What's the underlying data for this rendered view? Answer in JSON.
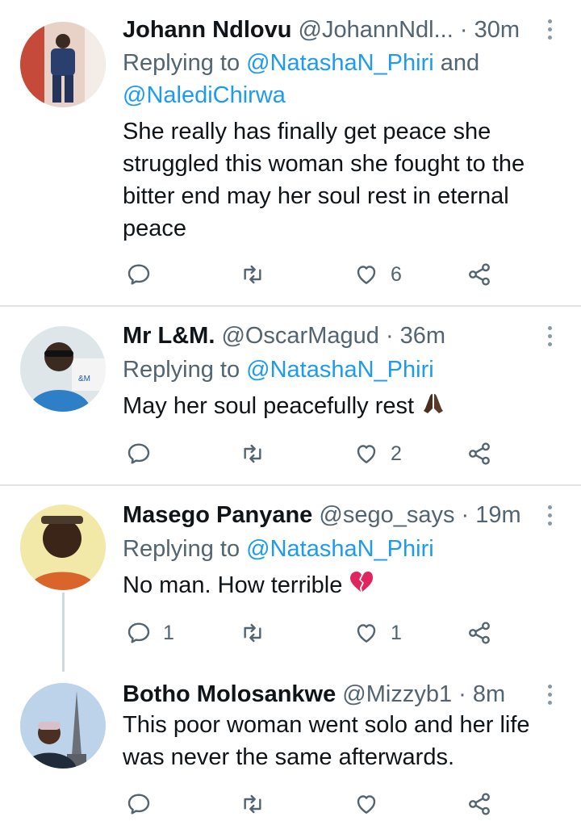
{
  "tweets": [
    {
      "name": "Johann Ndlovu",
      "handle": "@JohannNdl...",
      "time": "· 30m",
      "replying_prefix": "Replying to ",
      "replying_line1_mention": "@NatashaN_Phiri",
      "replying_line1_suffix": " and",
      "replying_line2_mention": "@NalediChirwa",
      "body_lines": [
        "She really has finally get peace she",
        "struggled this woman she fought to the",
        "bitter end may her soul rest in eternal",
        "peace"
      ],
      "reply_count": "",
      "retweet_count": "",
      "like_count": "6"
    },
    {
      "name": "Mr L&M.",
      "handle": "@OscarMagud",
      "time": "· 36m",
      "replying_prefix": "Replying to ",
      "replying_mention": "@NatashaN_Phiri",
      "body": "May her soul peacefully rest",
      "body_emoji": "praying-hands",
      "reply_count": "",
      "retweet_count": "",
      "like_count": "2"
    },
    {
      "name": "Masego Panyane",
      "handle": "@sego_says",
      "time": "· 19m",
      "replying_prefix": "Replying to ",
      "replying_mention": "@NatashaN_Phiri",
      "body": "No man. How terrible",
      "body_emoji": "broken-heart",
      "reply_count": "1",
      "retweet_count": "",
      "like_count": "1"
    },
    {
      "name": "Botho Molosankwe",
      "handle": "@Mizzyb1",
      "time": "· 8m",
      "body_lines": [
        "This poor woman went solo and her life",
        "was never the same afterwards."
      ],
      "reply_count": "",
      "retweet_count": "",
      "like_count": ""
    }
  ],
  "colors": {
    "accent": "#1d9bf0",
    "secondary_text": "#536471",
    "divider": "#dfe3e6"
  },
  "icons": [
    "reply-icon",
    "retweet-icon",
    "like-icon",
    "share-icon",
    "more-options-icon"
  ]
}
